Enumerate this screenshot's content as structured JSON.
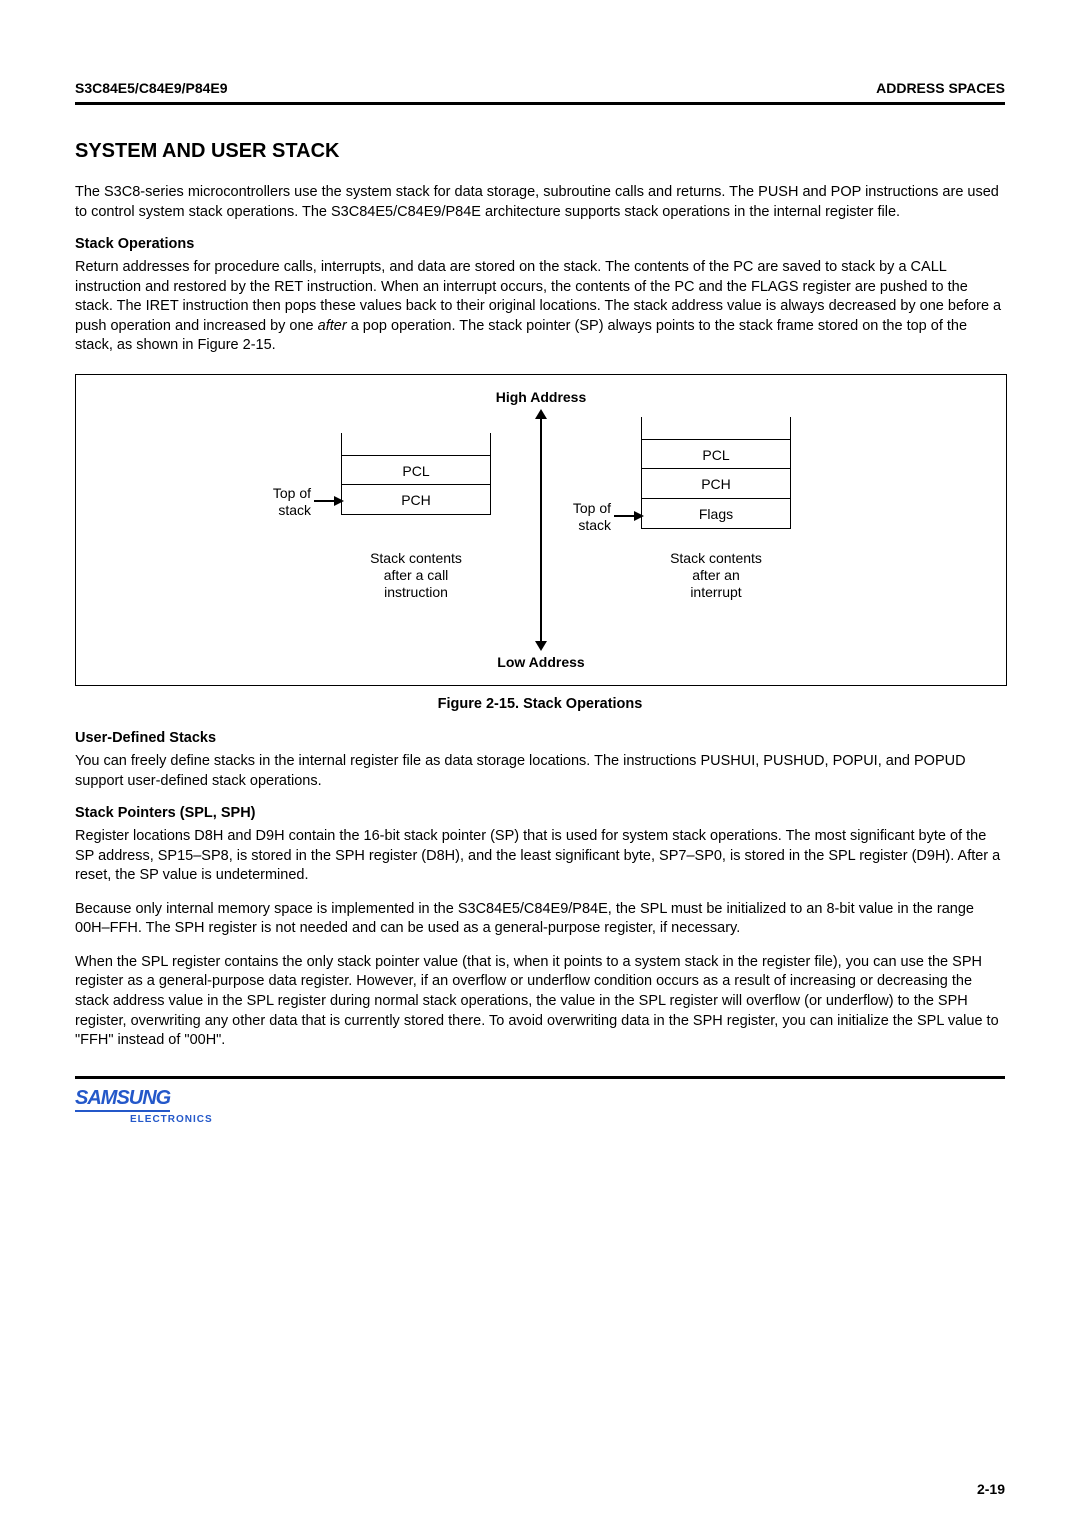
{
  "header": {
    "left": "S3C84E5/C84E9/P84E9",
    "right": "ADDRESS SPACES"
  },
  "title": "SYSTEM AND USER STACK",
  "intro": "The S3C8-series microcontrollers use the system stack for data storage, subroutine calls and returns. The PUSH and POP instructions are used to control system stack operations. The S3C84E5/C84E9/P84E architecture supports stack operations in the internal register file.",
  "sec1_head": "Stack Operations",
  "sec1_body_a": "Return addresses for procedure calls, interrupts, and data are stored on the stack. The contents of the PC are saved to stack by a CALL instruction and restored by the RET instruction. When an interrupt occurs, the contents of the PC and the FLAGS register are pushed to the stack. The IRET instruction then pops these values back to their original locations. The stack address value is always decreased by one before a push operation and increased by one ",
  "sec1_body_after": "after",
  "sec1_body_b": " a pop operation. The stack pointer (SP) always points to the stack frame stored on the top of the stack, as shown in Figure 2-15.",
  "diagram": {
    "high": "High Address",
    "low": "Low Address",
    "top_of_stack": "Top of\nstack",
    "left_stack": [
      "PCL",
      "PCH"
    ],
    "right_stack": [
      "PCL",
      "PCH",
      "Flags"
    ],
    "left_caption": "Stack contents\nafter a call\ninstruction",
    "right_caption": "Stack contents\nafter an\ninterrupt"
  },
  "fig_caption": "Figure 2-15. Stack Operations",
  "sec2_head": "User-Defined Stacks",
  "sec2_body": "You can freely define stacks in the internal register file as data storage locations. The instructions PUSHUI, PUSHUD, POPUI, and POPUD support user-defined stack operations.",
  "sec3_head": "Stack Pointers (SPL, SPH)",
  "sec3_p1": "Register locations D8H and D9H contain the 16-bit stack pointer (SP) that is used for system stack operations. The most significant byte of the SP address, SP15–SP8, is stored in the SPH register (D8H), and the least significant byte, SP7–SP0, is stored in the SPL register (D9H). After a reset, the SP value is undetermined.",
  "sec3_p2": "Because only internal memory space is implemented in the S3C84E5/C84E9/P84E, the SPL must be initialized to an 8-bit value in the range 00H–FFH. The SPH register is not needed and can be used as a general-purpose register, if necessary.",
  "sec3_p3": "When the SPL register contains the only stack pointer value (that is, when it points to a system stack in the register file), you can use the SPH register as a general-purpose data register. However, if an overflow or underflow condition occurs as a result of increasing or decreasing the stack address value in the SPL register during normal stack operations, the value in the SPL register will overflow (or underflow) to the SPH register, overwriting any other data that is currently stored there. To avoid overwriting data in the SPH register, you can initialize the SPL value to \"FFH\" instead of \"00H\".",
  "logo": "SAMSUNG",
  "electronics": "ELECTRONICS",
  "page_num": "2-19"
}
